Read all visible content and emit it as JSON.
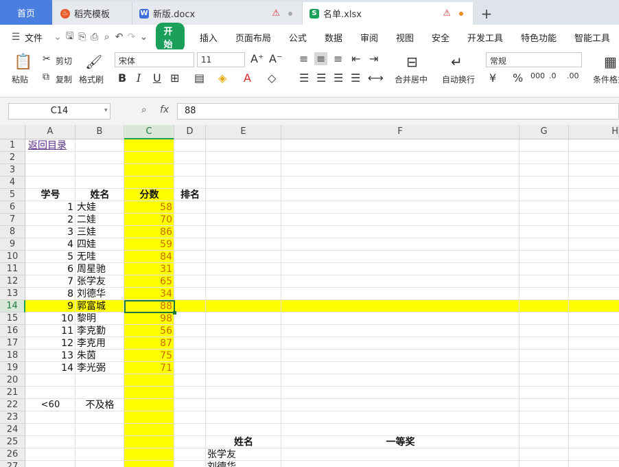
{
  "tabs": {
    "home": "首页",
    "doc1": "稻壳模板",
    "doc2": "新版.docx",
    "doc3": "名单.xlsx",
    "doc3_dot_color": "#f08a24"
  },
  "menu": {
    "file": "文件",
    "items": [
      "开始",
      "插入",
      "页面布局",
      "公式",
      "数据",
      "审阅",
      "视图",
      "安全",
      "开发工具",
      "特色功能",
      "智能工具"
    ]
  },
  "ribbon": {
    "paste": "粘贴",
    "cut": "剪切",
    "copy": "复制",
    "format_painter": "格式刷",
    "font_name": "宋体",
    "font_size": "11",
    "merge_center": "合并居中",
    "wrap_text": "自动换行",
    "number_format": "常规",
    "cond_format": "条件格式"
  },
  "formula_bar": {
    "name_box": "C14",
    "fx": "fx",
    "formula": "88"
  },
  "columns": [
    "A",
    "B",
    "C",
    "D",
    "E",
    "F",
    "G",
    "H"
  ],
  "rows": [
    "1",
    "2",
    "3",
    "4",
    "5",
    "6",
    "7",
    "8",
    "9",
    "10",
    "11",
    "12",
    "13",
    "14",
    "15",
    "16",
    "17",
    "18",
    "19",
    "20",
    "21",
    "22",
    "23",
    "24",
    "25",
    "26",
    "27"
  ],
  "sheet": {
    "a1_link": "返回目录",
    "headers": {
      "id": "学号",
      "name": "姓名",
      "score": "分数",
      "rank": "排名"
    },
    "students": [
      {
        "id": "1",
        "name": "大娃",
        "score": "58"
      },
      {
        "id": "2",
        "name": "二娃",
        "score": "70"
      },
      {
        "id": "3",
        "name": "三娃",
        "score": "86"
      },
      {
        "id": "4",
        "name": "四娃",
        "score": "59"
      },
      {
        "id": "5",
        "name": "无哇",
        "score": "84"
      },
      {
        "id": "6",
        "name": "周星驰",
        "score": "31"
      },
      {
        "id": "7",
        "name": "张学友",
        "score": "65"
      },
      {
        "id": "8",
        "name": "刘德华",
        "score": "34"
      },
      {
        "id": "9",
        "name": "郭富城",
        "score": "88"
      },
      {
        "id": "10",
        "name": "黎明",
        "score": "98"
      },
      {
        "id": "11",
        "name": "李克勤",
        "score": "56"
      },
      {
        "id": "12",
        "name": "李克用",
        "score": "87"
      },
      {
        "id": "13",
        "name": "朱茵",
        "score": "75"
      },
      {
        "id": "14",
        "name": "李光弼",
        "score": "71"
      }
    ],
    "criteria_label": "<60",
    "criteria_value": "不及格",
    "award_name_header": "姓名",
    "award_header": "一等奖",
    "award_names": [
      "张学友",
      "刘德华"
    ]
  },
  "colors": {
    "accent": "#1aa05a",
    "highlight": "#ffff00",
    "score_text": "#c86a00"
  }
}
